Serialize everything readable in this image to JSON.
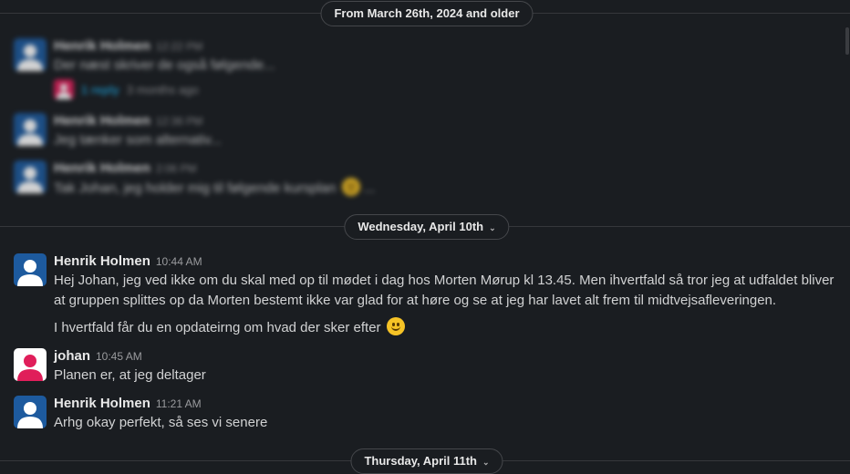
{
  "dividers": {
    "older": "From March 26th, 2024 and older",
    "wed": "Wednesday, April 10th",
    "thu": "Thursday, April 11th"
  },
  "blurred_messages": [
    {
      "author": "Henrik Holmen",
      "time": "12:22 PM",
      "text": "Der næst skriver de også følgende...",
      "reply_count": "1 reply",
      "reply_ago": "3 months ago"
    },
    {
      "author": "Henrik Holmen",
      "time": "12:36 PM",
      "text": "Jeg tænker som alternativ..."
    },
    {
      "author": "Henrik Holmen",
      "time": "2:06 PM",
      "text": "Tak Johan, jeg holder mig til følgende kursplan"
    }
  ],
  "messages": [
    {
      "author": "Henrik Holmen",
      "time": "10:44 AM",
      "text1": "Hej Johan, jeg ved ikke om du skal med op til mødet i dag hos Morten Mørup kl 13.45. Men ihvertfald så tror jeg at udfaldet bliver at gruppen splittes op da Morten bestemt ikke var glad for at høre og se at jeg har lavet alt frem til midtvejsafleveringen.",
      "text2": "I hvertfald får du en opdateirng om hvad der sker efter"
    },
    {
      "author": "johan",
      "time": "10:45 AM",
      "text": "Planen er, at jeg deltager"
    },
    {
      "author": "Henrik Holmen",
      "time": "11:21 AM",
      "text": "Arhg okay perfekt, så ses vi senere"
    }
  ],
  "icons": {
    "chevron": "chevron-down-icon",
    "emoji": "slightly-smiling-face-icon",
    "avatar": "user-avatar-icon"
  },
  "colors": {
    "background": "#1a1d21",
    "henrik_avatar": "#1d5a9e",
    "johan_avatar": "#e01e5a",
    "link": "#1d9bd1"
  }
}
